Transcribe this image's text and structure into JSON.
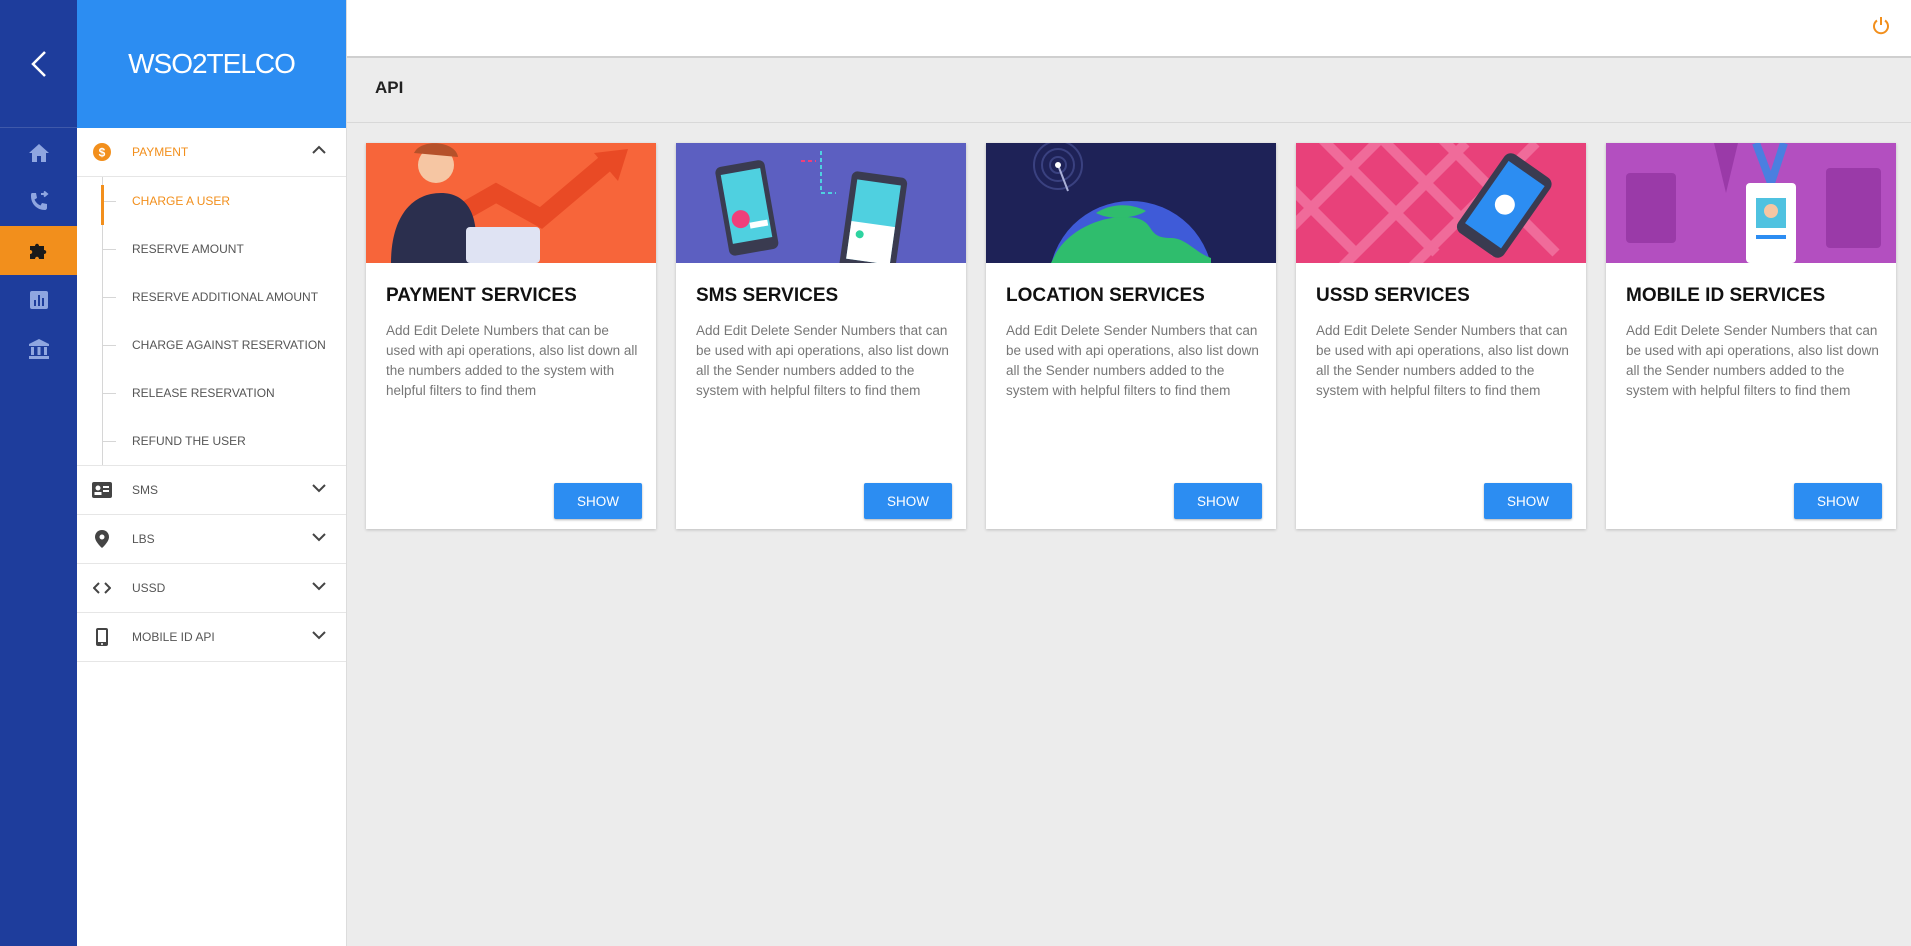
{
  "app": {
    "logo_text": "WSO2TELCO"
  },
  "rail": {
    "items": [
      {
        "icon": "home-icon"
      },
      {
        "icon": "phone-forward-icon"
      },
      {
        "icon": "puzzle-icon",
        "active": true
      },
      {
        "icon": "chart-icon"
      },
      {
        "icon": "bank-icon"
      }
    ]
  },
  "menu": {
    "payment": {
      "label": "PAYMENT",
      "items": [
        "CHARGE A USER",
        "RESERVE AMOUNT",
        "RESERVE ADDITIONAL AMOUNT",
        "CHARGE AGAINST RESERVATION",
        "RELEASE RESERVATION",
        "REFUND THE USER"
      ]
    },
    "sms": {
      "label": "SMS"
    },
    "lbs": {
      "label": "LBS"
    },
    "ussd": {
      "label": "USSD"
    },
    "mobile_id": {
      "label": "MOBILE ID API"
    }
  },
  "page": {
    "title": "API"
  },
  "cards": [
    {
      "title": "PAYMENT SERVICES",
      "desc": "Add Edit Delete Numbers that can be used with api operations, also list down all the numbers added to the system with helpful filters to find them",
      "button": "SHOW"
    },
    {
      "title": "SMS SERVICES",
      "desc": "Add Edit Delete Sender Numbers that can be used with api operations, also list down all the Sender numbers added to the system with helpful filters to find them",
      "button": "SHOW"
    },
    {
      "title": "LOCATION SERVICES",
      "desc": "Add Edit Delete Sender Numbers that can be used with api operations, also list down all the Sender numbers added to the system with helpful filters to find them",
      "button": "SHOW"
    },
    {
      "title": "USSD SERVICES",
      "desc": "Add Edit Delete Sender Numbers that can be used with api operations, also list down all the Sender numbers added to the system with helpful filters to find them",
      "button": "SHOW"
    },
    {
      "title": "MOBILE ID SERVICES",
      "desc": "Add Edit Delete Sender Numbers that can be used with api operations, also list down all the Sender numbers added to the system with helpful filters to find them",
      "button": "SHOW"
    }
  ],
  "colors": {
    "rail": "#1e3d9c",
    "brand": "#2c8df2",
    "accent": "#f28f1c",
    "button": "#2c8df2"
  }
}
